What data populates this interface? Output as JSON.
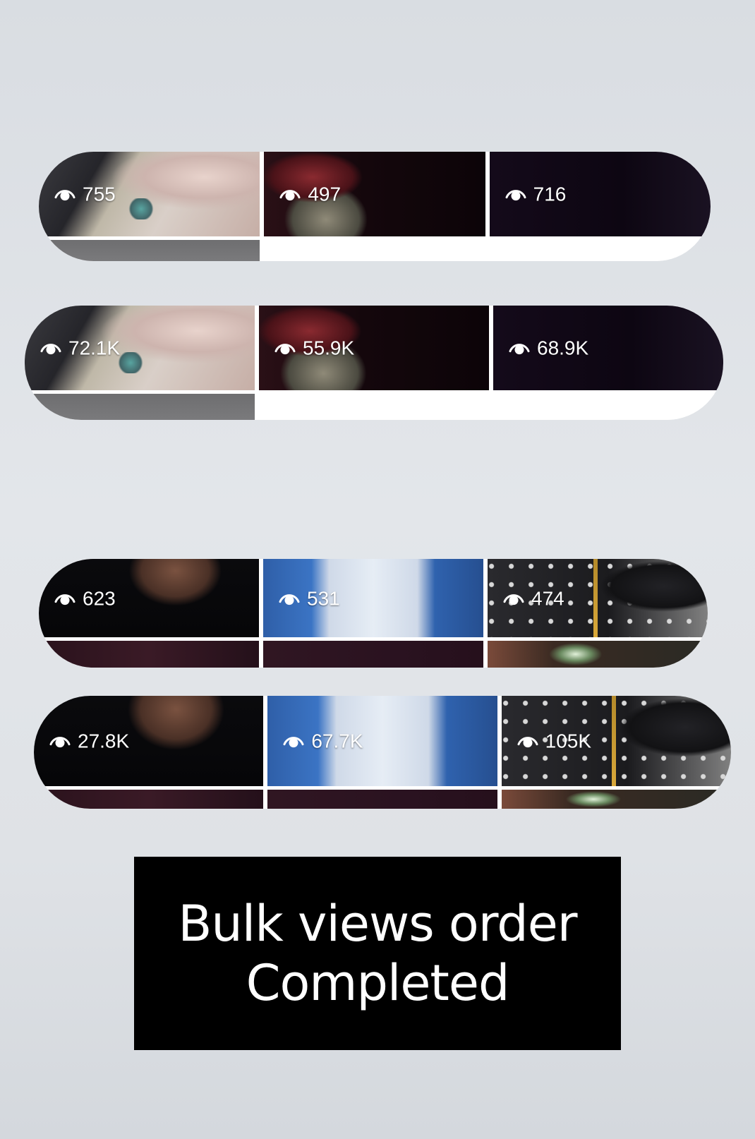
{
  "strips": [
    {
      "tiles": [
        {
          "views": "755",
          "thumb": "hand",
          "bottom": "gray"
        },
        {
          "views": "497",
          "thumb": "car",
          "bottom": "white"
        },
        {
          "views": "716",
          "thumb": "dark",
          "bottom": "white"
        }
      ]
    },
    {
      "tiles": [
        {
          "views": "72.1K",
          "thumb": "hand",
          "bottom": "gray"
        },
        {
          "views": "55.9K",
          "thumb": "car",
          "bottom": "white"
        },
        {
          "views": "68.9K",
          "thumb": "dark",
          "bottom": "white"
        }
      ]
    },
    {
      "tiles": [
        {
          "views": "623",
          "thumb": "neck",
          "bottom": "plum"
        },
        {
          "views": "531",
          "thumb": "denim",
          "bottom": "plum2"
        },
        {
          "views": "474",
          "thumb": "shoe",
          "bottom": "glow"
        }
      ]
    },
    {
      "tiles": [
        {
          "views": "27.8K",
          "thumb": "neck",
          "bottom": "plum"
        },
        {
          "views": "67.7K",
          "thumb": "denim",
          "bottom": "plum2"
        },
        {
          "views": "105K",
          "thumb": "shoe",
          "bottom": "glow"
        }
      ]
    }
  ],
  "icons": {
    "views": "eye-icon"
  },
  "caption": {
    "line1": "Bulk views order",
    "line2": "Completed"
  },
  "colors": {
    "caption_bg": "#000000",
    "caption_text": "#ffffff",
    "views_text": "#ffffff"
  }
}
